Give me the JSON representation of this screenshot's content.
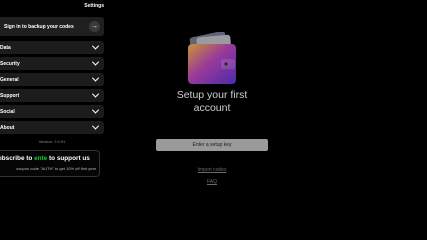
{
  "sidebar": {
    "title": "Settings",
    "signin": {
      "label": "Sign in to backup your codes",
      "icon": "arrow-right-icon"
    },
    "items": [
      {
        "label": "Data"
      },
      {
        "label": "Security"
      },
      {
        "label": "General"
      },
      {
        "label": "Support"
      },
      {
        "label": "Social"
      },
      {
        "label": "About"
      }
    ],
    "version": "Version: 2.0.91",
    "promo": {
      "title_prefix": "ıbscribe to ",
      "title_accent": "ente",
      "title_suffix": " to support us",
      "subtitle": "coupon code \"AUTH\" to get 10% off first year",
      "accent_color": "#2fb84a"
    }
  },
  "main": {
    "heading_line1": "Setup your first",
    "heading_line2": "account",
    "setup_button": "Enter a setup key",
    "import_link": "Import codes",
    "faq_link": "FAQ"
  }
}
